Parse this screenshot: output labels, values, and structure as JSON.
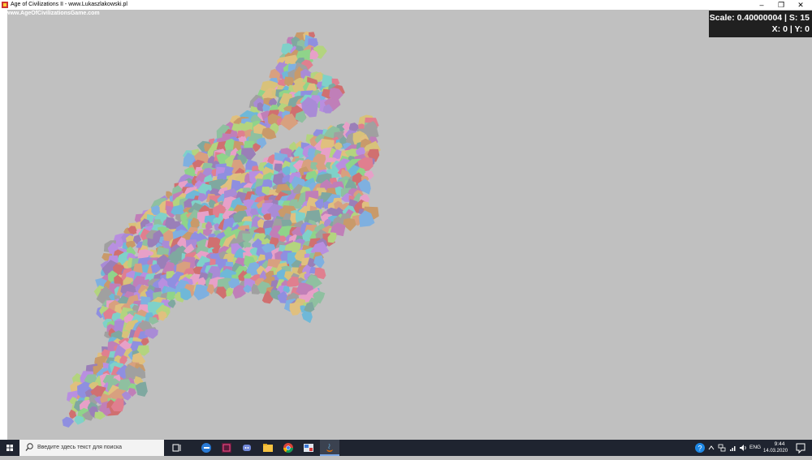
{
  "window": {
    "title": "Age of Civilizations II - www.Lukaszlakowski.pl",
    "minimize": "–",
    "maximize": "❐",
    "close": "✕"
  },
  "game": {
    "website": "www.AgeOfCivilizationsGame.com",
    "hud_scale": "Scale: 0.40000004 | S: 15",
    "hud_xy": "X: 0 | Y: 0"
  },
  "taskbar": {
    "search_placeholder": "Введите здесь текст для поиска",
    "apps": [
      "task-view-icon",
      "edge-icon",
      "winrar-icon",
      "discord-icon",
      "file-explorer-icon",
      "chrome-icon",
      "paint-icon",
      "java-icon"
    ],
    "language": "ENG",
    "time": "9:44",
    "date": "14.03.2020"
  },
  "colors": {
    "background": "#c0c0c0",
    "taskbar": "#1f2430",
    "hud": "#202020"
  }
}
